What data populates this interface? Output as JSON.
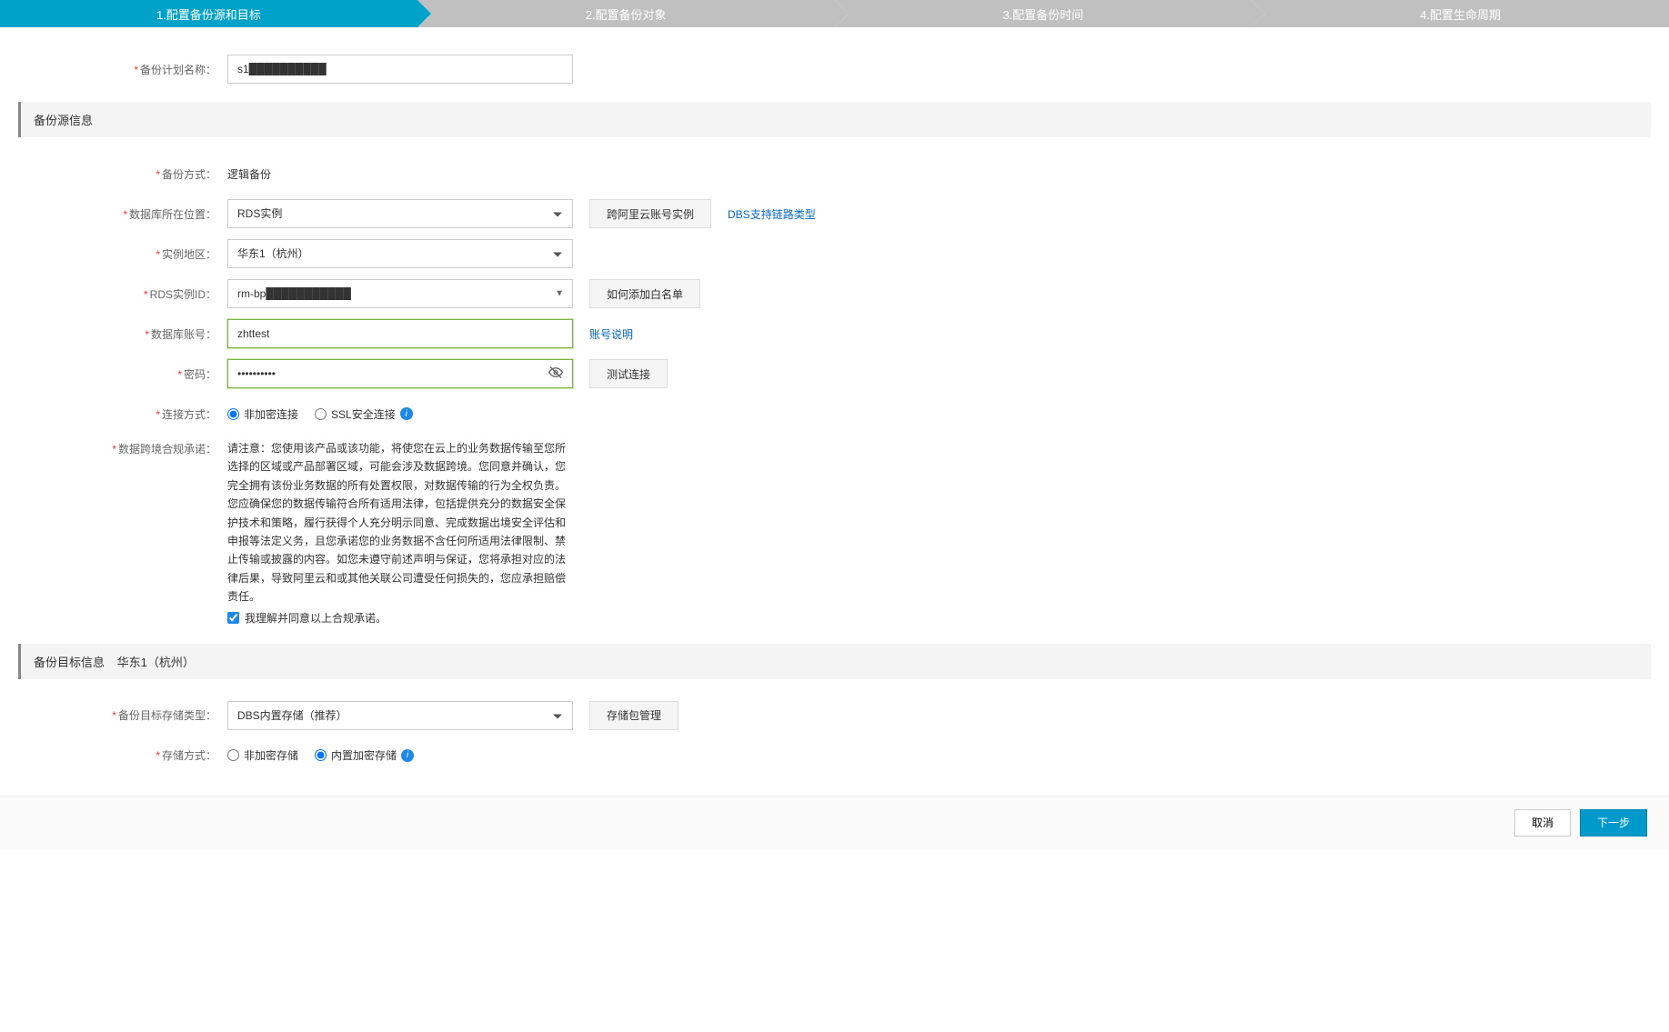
{
  "steps": {
    "s1": "1.配置备份源和目标",
    "s2": "2.配置备份对象",
    "s3": "3.配置备份时间",
    "s4": "4.配置生命周期"
  },
  "labels": {
    "plan_name": "备份计划名称：",
    "backup_method": "备份方式：",
    "db_location": "数据库所在位置：",
    "instance_region": "实例地区：",
    "rds_instance_id": "RDS实例ID：",
    "db_account": "数据库账号：",
    "password": "密码：",
    "connection_mode": "连接方式：",
    "compliance": "数据跨境合规承诺：",
    "target_storage_type": "备份目标存储类型：",
    "storage_mode": "存储方式："
  },
  "values": {
    "plan_name": "s1██████████",
    "backup_method": "逻辑备份",
    "db_location": "RDS实例",
    "instance_region": "华东1（杭州）",
    "rds_instance_id": "rm-bp███████████",
    "db_account": "zhttest",
    "password": "••••••••••",
    "target_storage_type": "DBS内置存储（推荐）"
  },
  "buttons": {
    "cross_account": "跨阿里云账号实例",
    "add_whitelist": "如何添加白名单",
    "test_connection": "测试连接",
    "storage_manage": "存储包管理",
    "cancel": "取消",
    "next": "下一步"
  },
  "links": {
    "dbs_support": "DBS支持链路类型",
    "account_help": "账号说明"
  },
  "radios": {
    "conn_plain": "非加密连接",
    "conn_ssl": "SSL安全连接",
    "store_plain": "非加密存储",
    "store_encrypt": "内置加密存储"
  },
  "sections": {
    "source_info": "备份源信息",
    "target_info": "备份目标信息",
    "target_region": "华东1（杭州）"
  },
  "compliance": {
    "text": "请注意：您使用该产品或该功能，将使您在云上的业务数据传输至您所选择的区域或产品部署区域，可能会涉及数据跨境。您同意并确认，您完全拥有该份业务数据的所有处置权限，对数据传输的行为全权负责。您应确保您的数据传输符合所有适用法律，包括提供充分的数据安全保护技术和策略，履行获得个人充分明示同意、完成数据出境安全评估和申报等法定义务，且您承诺您的业务数据不含任何所适用法律限制、禁止传输或披露的内容。如您未遵守前述声明与保证，您将承担对应的法律后果，导致阿里云和或其他关联公司遭受任何损失的，您应承担赔偿责任。",
    "checkbox": "我理解并同意以上合规承诺。"
  }
}
